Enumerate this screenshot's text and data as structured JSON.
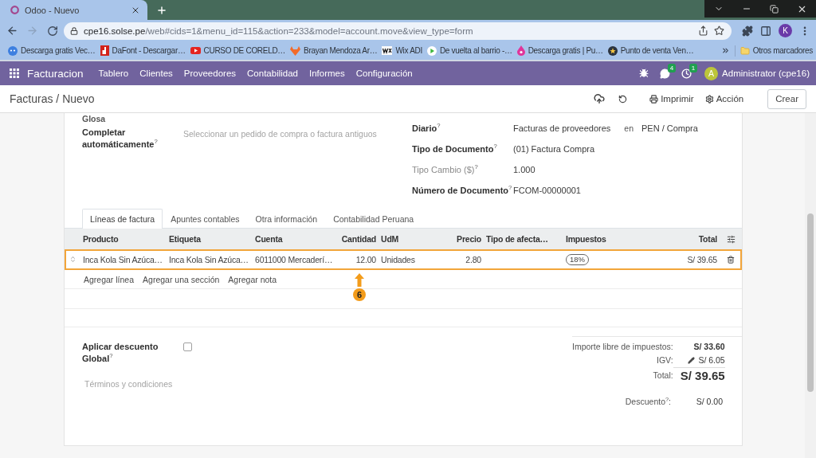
{
  "browser": {
    "tab_title": "Odoo - Nuevo",
    "forward_enabled": false,
    "url": {
      "host": "cpe16.solse.pe",
      "path": "/web#cids=1&menu_id=115&action=233&model=account.move&view_type=form"
    },
    "profile_initial": "K",
    "bookmarks": [
      {
        "label": "Descarga gratis Vec…",
        "kind": "bot"
      },
      {
        "label": "DaFont - Descargar…",
        "kind": "letter-tile"
      },
      {
        "label": "CURSO DE CORELD…",
        "kind": "video"
      },
      {
        "label": "Brayan Mendoza Ar…",
        "kind": "fox"
      },
      {
        "label": "Wix ADI",
        "kind": "wordmark"
      },
      {
        "label": "De vuelta al barrio -…",
        "kind": "play"
      },
      {
        "label": "Descarga gratis | Pu…",
        "kind": "drop"
      },
      {
        "label": "Punto de venta Ven…",
        "kind": "star-badge"
      }
    ],
    "other_bookmarks": "Otros marcadores"
  },
  "navbar": {
    "app_name": "Facturacion",
    "menu": [
      "Tablero",
      "Clientes",
      "Proveedores",
      "Contabilidad",
      "Informes",
      "Configuración"
    ],
    "messages_count": "4",
    "activities_count": "1",
    "user_initial": "A",
    "user_name": "Administrator (cpe16)"
  },
  "control_panel": {
    "breadcrumb": "Facturas / Nuevo",
    "print_label": "Imprimir",
    "action_label": "Acción",
    "create_label": "Crear"
  },
  "form": {
    "cut_label": "Glosa",
    "autocomplete": {
      "label": "Completar automáticamente$^{?}$",
      "placeholder": "Seleccionar un pedido de compra o factura antiguos"
    },
    "fields": [
      {
        "label": "Diario$^{?}$",
        "value": "Facturas de proveedores",
        "connector": "en",
        "extra": "PEN / Compra",
        "muted": false
      },
      {
        "label": "Tipo de Documento$^{?}$",
        "value": "(01) Factura Compra",
        "muted": false
      },
      {
        "label": "Tipo Cambio ($)$^{?}$",
        "value": "1.000",
        "muted": true
      },
      {
        "label": "Número de Documento$^{?}$",
        "value": "FCOM-00000001",
        "muted": false
      }
    ],
    "tabs": [
      {
        "label": "Líneas de factura",
        "selected": true
      },
      {
        "label": "Apuntes contables",
        "selected": false
      },
      {
        "label": "Otra información",
        "selected": false
      },
      {
        "label": "Contabilidad Peruana",
        "selected": false
      }
    ],
    "lines": {
      "columns": [
        "Producto",
        "Etiqueta",
        "Cuenta",
        "Cantidad",
        "UdM",
        "Precio",
        "Tipo de afecta…",
        "Impuestos",
        "Total"
      ],
      "rows": [
        {
          "product": "Inca Kola Sin Azúca…",
          "label": "Inca Kola Sin Azúca…",
          "account": "6011000 Mercaderí…",
          "quantity": "12.00",
          "uom": "Unidades",
          "price": "2.80",
          "taxes": [
            "18%"
          ],
          "total": "S/ 39.65",
          "highlighted": true
        }
      ],
      "actions": [
        "Agregar línea",
        "Agregar una sección",
        "Agregar nota"
      ],
      "annotation": {
        "step": "6"
      }
    },
    "global_discount": {
      "label": "Aplicar descuento Global$^{?}$",
      "checked": false
    },
    "terms_placeholder": "Términos y condiciones",
    "totals": [
      {
        "label": "Importe libre de impuestos:",
        "value": "S/ 33.60",
        "kind": "subtotal"
      },
      {
        "label": "IGV:",
        "value": "S/ 6.05",
        "kind": "tax"
      },
      {
        "label": "Total:",
        "value": "S/ 39.65",
        "kind": "total"
      }
    ],
    "discount": {
      "label": "Descuento$^{?}$:",
      "value": "S/ 0.00"
    }
  }
}
